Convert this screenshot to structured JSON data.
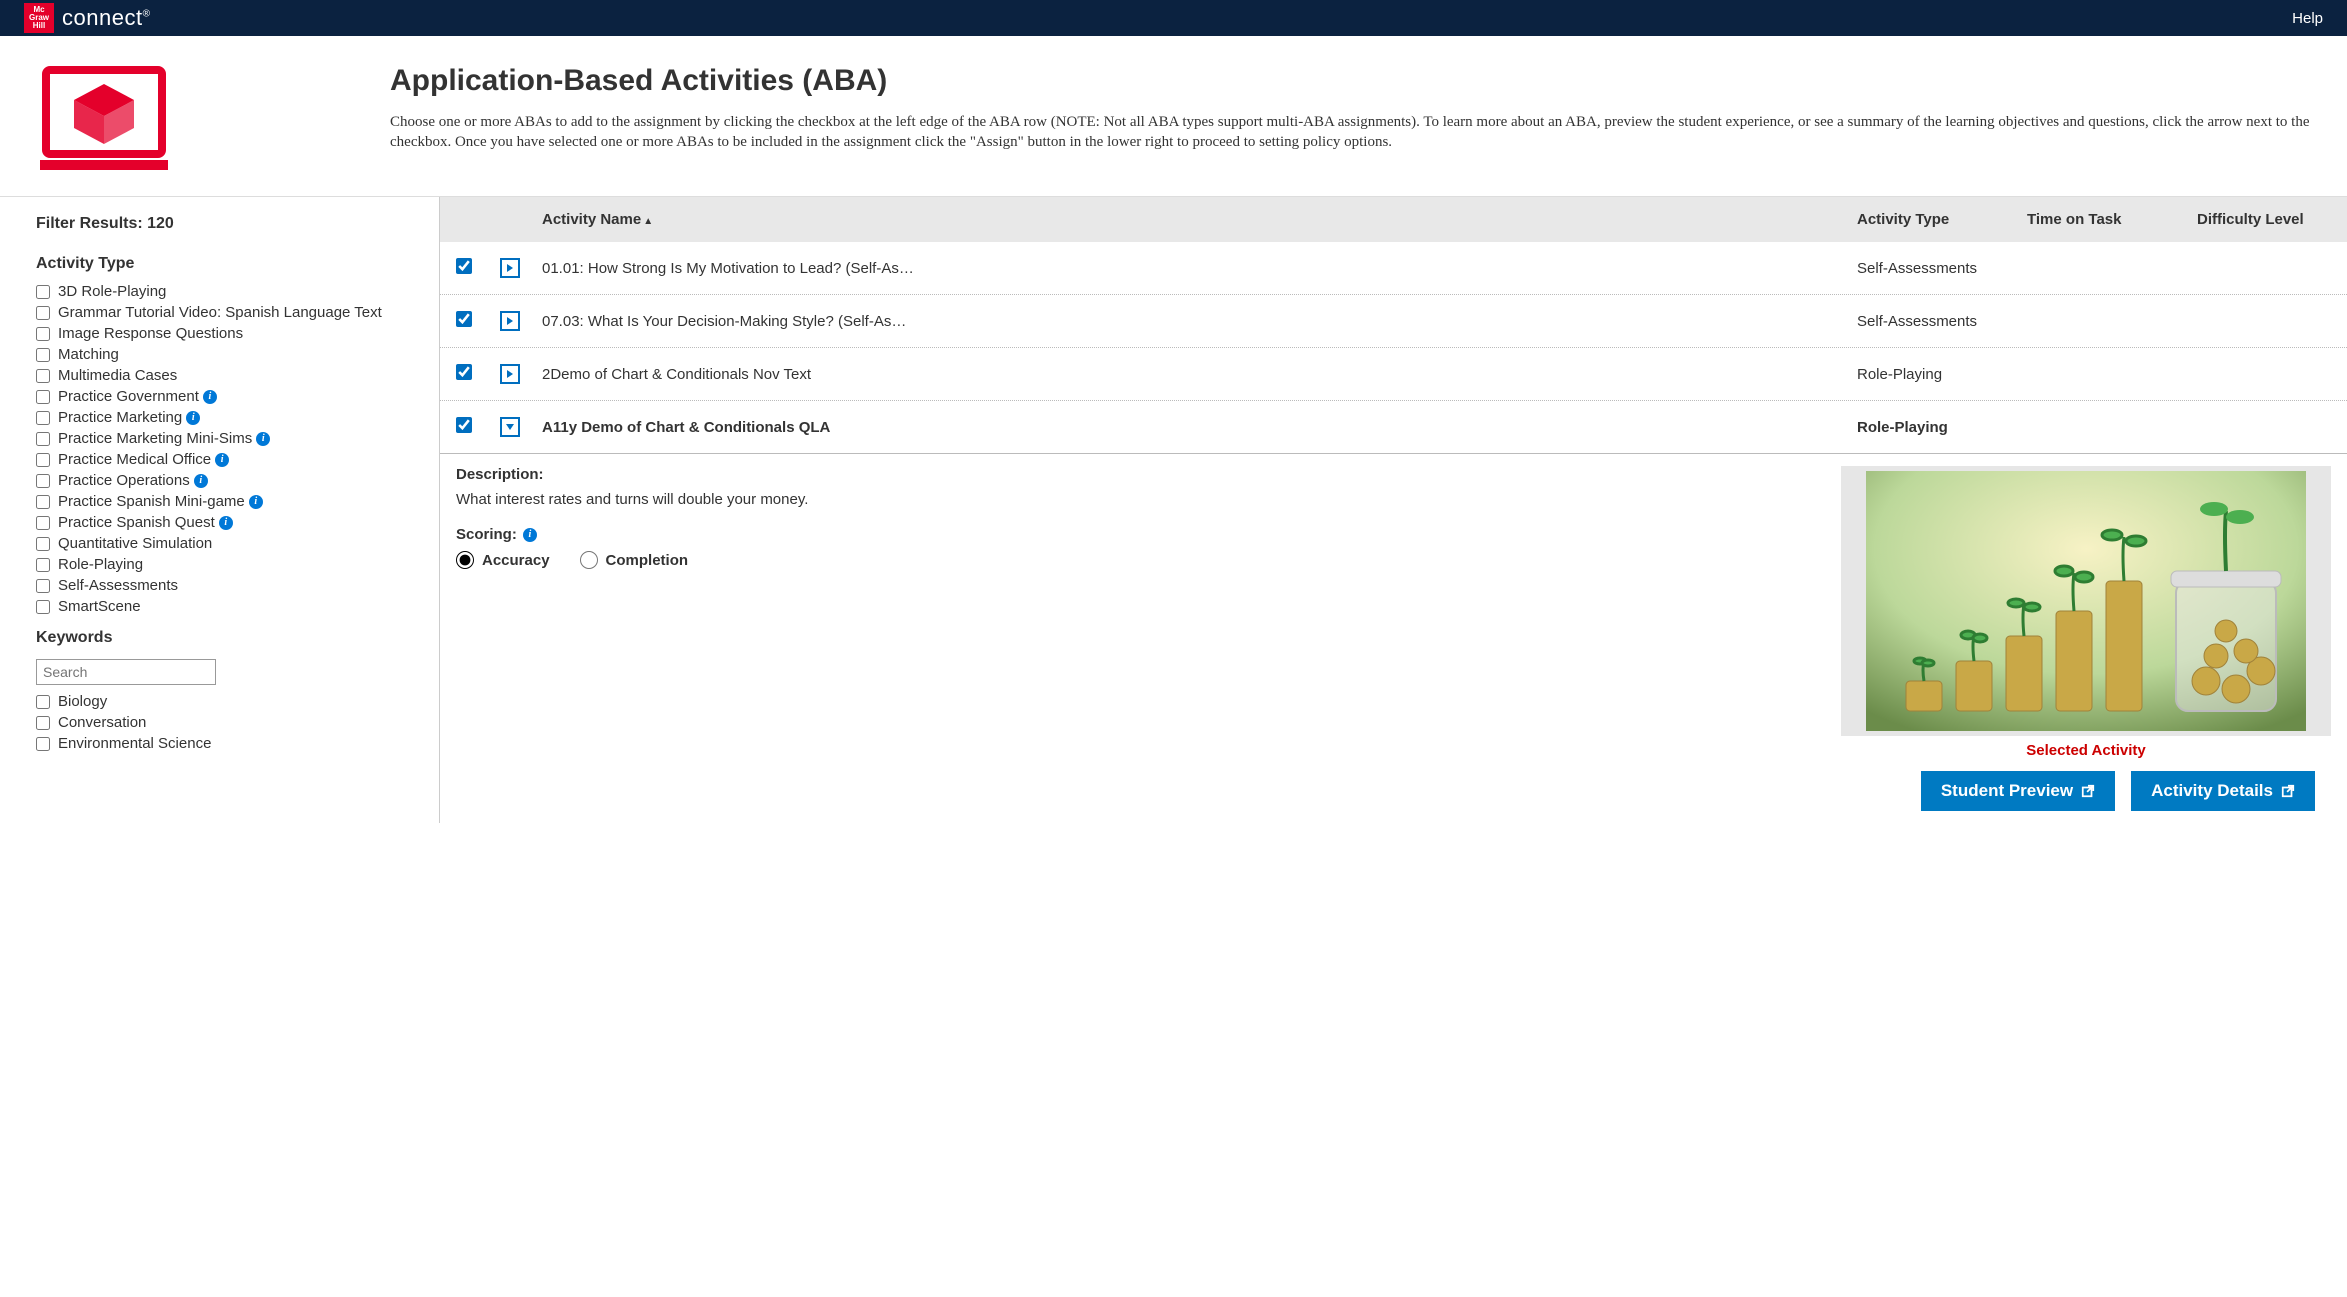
{
  "topbar": {
    "brand_logo_text": "Mc Graw Hill",
    "brand_text": "connect",
    "help": "Help"
  },
  "header": {
    "title": "Application-Based Activities (ABA)",
    "description": "Choose one or more ABAs to add to the assignment by clicking the checkbox at the left edge of the ABA row (NOTE: Not all ABA types support multi-ABA assignments). To learn more about an ABA, preview the student experience, or see a summary of the learning objectives and questions, click the arrow next to the checkbox. Once you have selected one or more ABAs to be included in the assignment click the \"Assign\" button in the lower right to proceed to setting policy options."
  },
  "sidebar": {
    "filter_results_label": "Filter Results: 120",
    "activity_type_title": "Activity Type",
    "activity_types": [
      {
        "label": "3D Role-Playing",
        "info": false
      },
      {
        "label": "Grammar Tutorial Video: Spanish Language Text",
        "info": false
      },
      {
        "label": "Image Response Questions",
        "info": false
      },
      {
        "label": "Matching",
        "info": false
      },
      {
        "label": "Multimedia Cases",
        "info": false
      },
      {
        "label": "Practice Government",
        "info": true
      },
      {
        "label": "Practice Marketing",
        "info": true
      },
      {
        "label": "Practice Marketing Mini-Sims",
        "info": true
      },
      {
        "label": "Practice Medical Office",
        "info": true
      },
      {
        "label": "Practice Operations",
        "info": true
      },
      {
        "label": "Practice Spanish Mini-game",
        "info": true
      },
      {
        "label": "Practice Spanish Quest",
        "info": true
      },
      {
        "label": "Quantitative Simulation",
        "info": false
      },
      {
        "label": "Role-Playing",
        "info": false
      },
      {
        "label": "Self-Assessments",
        "info": false
      },
      {
        "label": "SmartScene",
        "info": false
      }
    ],
    "keywords_title": "Keywords",
    "search_placeholder": "Search",
    "keywords": [
      {
        "label": "Biology"
      },
      {
        "label": "Conversation"
      },
      {
        "label": "Environmental Science"
      }
    ]
  },
  "table": {
    "headers": {
      "name": "Activity Name",
      "type": "Activity Type",
      "time": "Time on Task",
      "difficulty": "Difficulty Level"
    },
    "rows": [
      {
        "checked": true,
        "expanded": false,
        "name": "01.01: How Strong Is My Motivation to Lead? (Self-As…",
        "type": "Self-Assessments"
      },
      {
        "checked": true,
        "expanded": false,
        "name": "07.03: What Is Your Decision-Making Style? (Self-As…",
        "type": "Self-Assessments"
      },
      {
        "checked": true,
        "expanded": false,
        "name": "2Demo of Chart & Conditionals Nov Text",
        "type": "Role-Playing"
      },
      {
        "checked": true,
        "expanded": true,
        "name": "A11y Demo of Chart & Conditionals QLA",
        "type": "Role-Playing"
      }
    ]
  },
  "detail": {
    "description_label": "Description:",
    "description_text": "What interest rates and turns will double your money.",
    "scoring_label": "Scoring:",
    "scoring_options": {
      "accuracy": "Accuracy",
      "completion": "Completion"
    },
    "scoring_selected": "accuracy",
    "selected_activity_label": "Selected Activity"
  },
  "actions": {
    "student_preview": "Student Preview",
    "activity_details": "Activity Details"
  }
}
